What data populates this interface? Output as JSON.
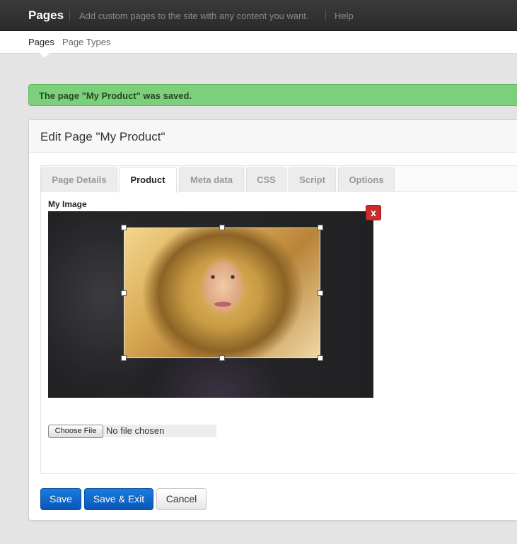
{
  "topbar": {
    "title": "Pages",
    "description": "Add custom pages to the site with any content you want.",
    "help": "Help"
  },
  "subnav": {
    "items": [
      {
        "label": "Pages"
      },
      {
        "label": "Page Types"
      }
    ]
  },
  "alert": {
    "message": "The page \"My Product\" was saved.",
    "color": "#7ccf7b"
  },
  "panel": {
    "title": "Edit Page \"My Product\""
  },
  "tabs": [
    {
      "label": "Page Details"
    },
    {
      "label": "Product"
    },
    {
      "label": "Meta data"
    },
    {
      "label": "CSS"
    },
    {
      "label": "Script"
    },
    {
      "label": "Options"
    }
  ],
  "image_field": {
    "label": "My Image",
    "remove_label": "x"
  },
  "file_input": {
    "button_label": "Choose File",
    "status": "No file chosen"
  },
  "actions": {
    "save": "Save",
    "save_exit": "Save & Exit",
    "cancel": "Cancel"
  },
  "colors": {
    "primary": "#0b64c8",
    "danger": "#cc2b2b",
    "success": "#7ccf7b"
  }
}
